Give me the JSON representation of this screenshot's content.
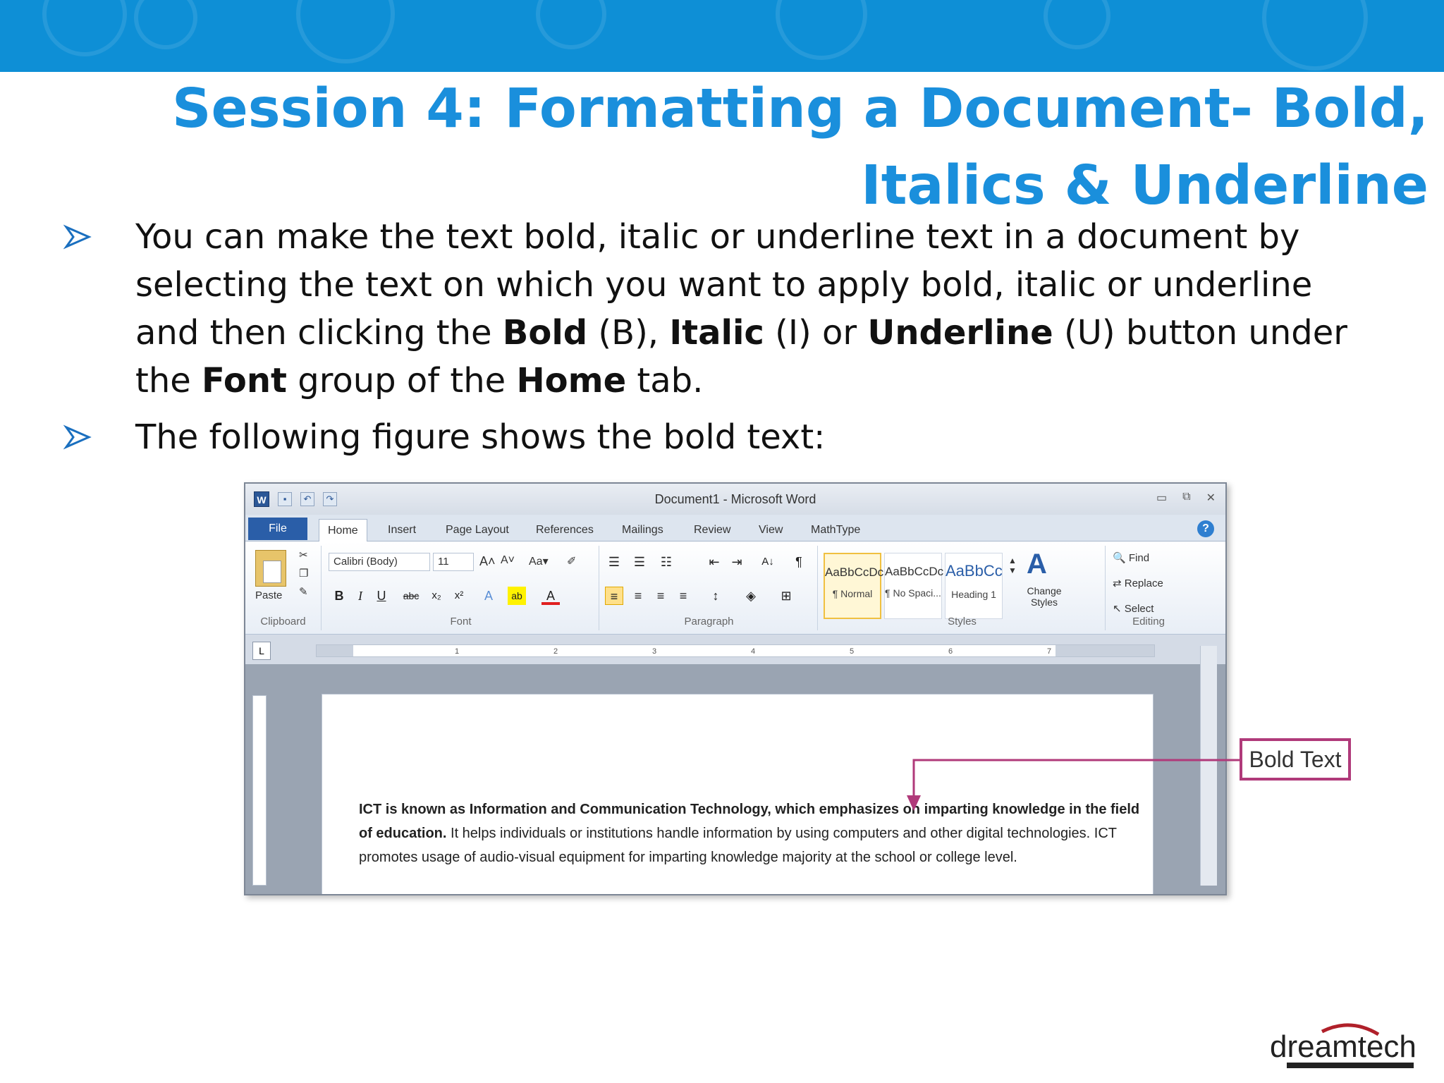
{
  "slide": {
    "title": "Session 4: Formatting a Document- Bold, Italics & Underline",
    "bullets": {
      "b1": {
        "t1": "You can make the text bold, italic or underline text in a document by selecting the text on which you want to apply bold, italic or underline and then clicking the ",
        "bold": "Bold",
        "t2": " (B), ",
        "italic": "Italic",
        "t3": " (I) or ",
        "underline": "Underline",
        "t4": " (U) button under the ",
        "font": "Font",
        "t5": " group of the ",
        "home": "Home",
        "t6": " tab."
      },
      "b2": "The following figure shows the bold text:"
    }
  },
  "word_window": {
    "title": "Document1 - Microsoft Word",
    "tabs": [
      "File",
      "Home",
      "Insert",
      "Page Layout",
      "References",
      "Mailings",
      "Review",
      "View",
      "MathType"
    ],
    "groups": {
      "clipboard": "Clipboard",
      "font": "Font",
      "paragraph": "Paragraph",
      "styles": "Styles",
      "editing": "Editing"
    },
    "paste_label": "Paste",
    "font_name": "Calibri (Body)",
    "font_size": "11",
    "styles": [
      {
        "preview": "AaBbCcDc",
        "name": "¶ Normal"
      },
      {
        "preview": "AaBbCcDc",
        "name": "¶ No Spaci..."
      },
      {
        "preview": "AaBbCc",
        "name": "Heading 1"
      }
    ],
    "change_styles": "Change Styles",
    "editing": {
      "find": "Find",
      "replace": "Replace",
      "select": "Select"
    },
    "ruler_numbers": [
      "1",
      "2",
      "3",
      "4",
      "5",
      "6",
      "7"
    ],
    "document_text": {
      "bold_part": "ICT is known as Information and Communication Technology, which emphasizes on imparting knowledge in the field of education.",
      "rest": " It helps individuals or institutions handle information by using computers and other digital technologies. ICT promotes usage of audio-visual equipment for imparting knowledge majority at the school or college level."
    }
  },
  "callout": "Bold Text",
  "logo_text": "dreamtech",
  "colors": {
    "band": "#0e8fd6",
    "title": "#1a8fdc",
    "callout": "#b03a7a"
  }
}
